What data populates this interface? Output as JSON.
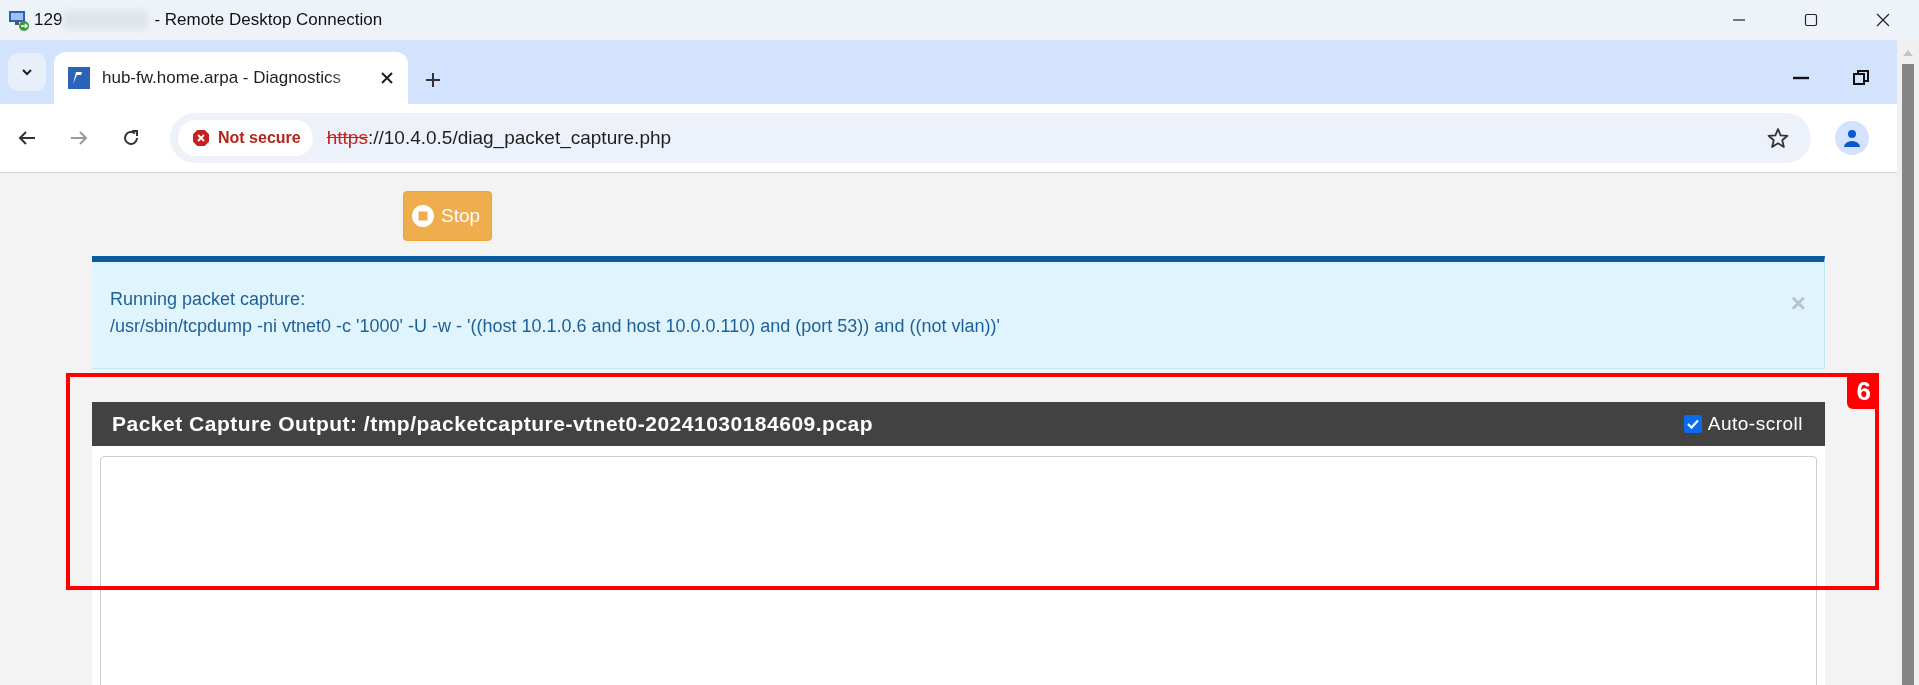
{
  "window": {
    "title_prefix": "129",
    "title": "- Remote Desktop Connection"
  },
  "browser": {
    "tabs": [
      {
        "title": "hub-fw.home.arpa - Diagnostics",
        "selected": true
      }
    ],
    "security": "Not secure",
    "url": {
      "scheme": "https",
      "rest": "://10.4.0.5/diag_packet_capture.php"
    }
  },
  "page": {
    "stop_button": "Stop",
    "alert": {
      "lines": [
        "Running packet capture:",
        "/usr/sbin/tcpdump -ni vtnet0 -c '1000' -U -w - '((host 10.1.0.6 and host 10.0.0.110) and (port 53)) and ((not vlan))'"
      ],
      "close_glyph": "×"
    },
    "output_panel": {
      "title": "Packet Capture Output: /tmp/packetcapture-vtnet0-20241030184609.pcap",
      "auto_scroll": {
        "label": "Auto-scroll",
        "checked": true
      }
    },
    "annotation": {
      "label": "6"
    }
  }
}
